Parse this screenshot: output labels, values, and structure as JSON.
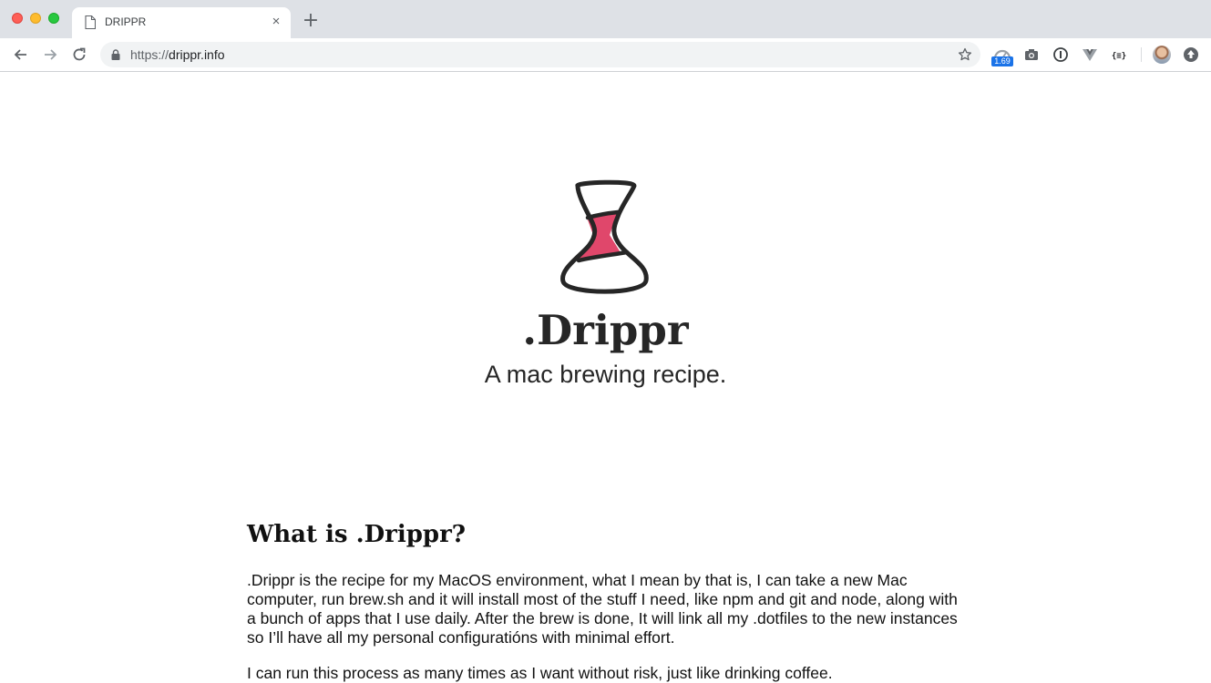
{
  "browser": {
    "tab_title": "DRIPPR",
    "tab_close": "×",
    "new_tab": "+",
    "url_scheme": "https://",
    "url_host": "drippr.info",
    "extension_badge": "1.69",
    "icons": [
      "back-arrow-icon",
      "forward-arrow-icon",
      "reload-icon",
      "lock-icon",
      "star-icon",
      "speed-extension-icon",
      "camera-icon",
      "password-manager-icon",
      "vue-devtools-icon",
      "json-viewer-icon",
      "avatar",
      "update-icon"
    ]
  },
  "hero": {
    "brand": ".Drippr",
    "tagline": "A mac brewing recipe."
  },
  "about": {
    "heading": "What is .Drippr?",
    "paragraph1": ".Drippr is the recipe for my MacOS environment, what I mean by that is, I can take a new Mac computer, run brew.sh and it will install most of the stuff I need, like npm and git and node, along with a bunch of apps that I use daily. After the brew is done, It will link all my .dotfiles to the new instances so I’ll have all my personal configuratións with minimal effort.",
    "paragraph2": "I can run this process as many times as I want without risk, just like drinking coffee."
  },
  "colors": {
    "accent": "#e0476b",
    "text": "#262626",
    "chrome_bg": "#dee1e6"
  }
}
